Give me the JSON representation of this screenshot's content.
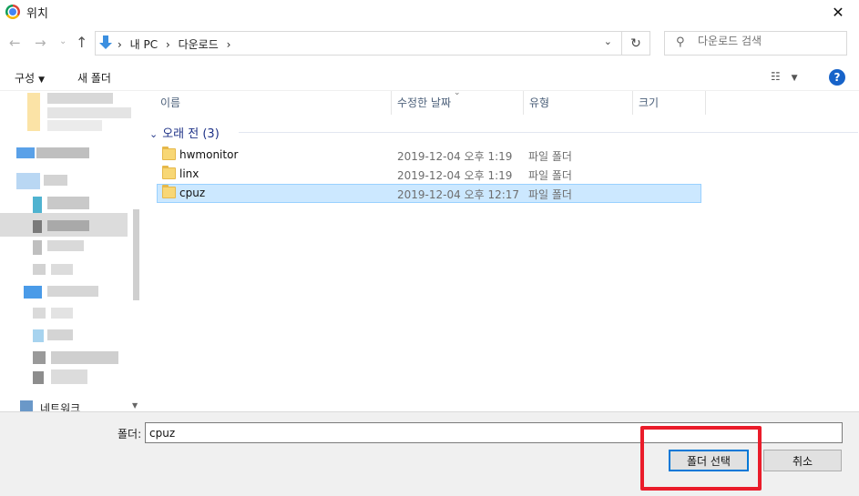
{
  "window": {
    "title": "위치"
  },
  "address": {
    "crumbs": [
      "›",
      "내 PC",
      "›",
      "다운로드",
      "›"
    ],
    "search_placeholder": "다운로드 검색"
  },
  "toolbar": {
    "organize": "구성",
    "new_folder": "새 폴더"
  },
  "nav_pane": {
    "network_label": "네트워크"
  },
  "columns": {
    "name": "이름",
    "modified": "수정한 날짜",
    "type": "유형",
    "size": "크기"
  },
  "group": {
    "label": "오래 전 (3)"
  },
  "files": [
    {
      "name": "hwmonitor",
      "date": "2019-12-04 오후 1:19",
      "type": "파일 폴더"
    },
    {
      "name": "linx",
      "date": "2019-12-04 오후 1:19",
      "type": "파일 폴더"
    },
    {
      "name": "cpuz",
      "date": "2019-12-04 오후 12:17",
      "type": "파일 폴더"
    }
  ],
  "footer": {
    "folder_label": "폴더:",
    "folder_value": "cpuz",
    "select_button": "폴더 선택",
    "cancel_button": "취소"
  },
  "colors": {
    "accent": "#0078d7",
    "selection": "#cce8ff",
    "highlight": "#ea1c2a",
    "help": "#1763c9"
  }
}
